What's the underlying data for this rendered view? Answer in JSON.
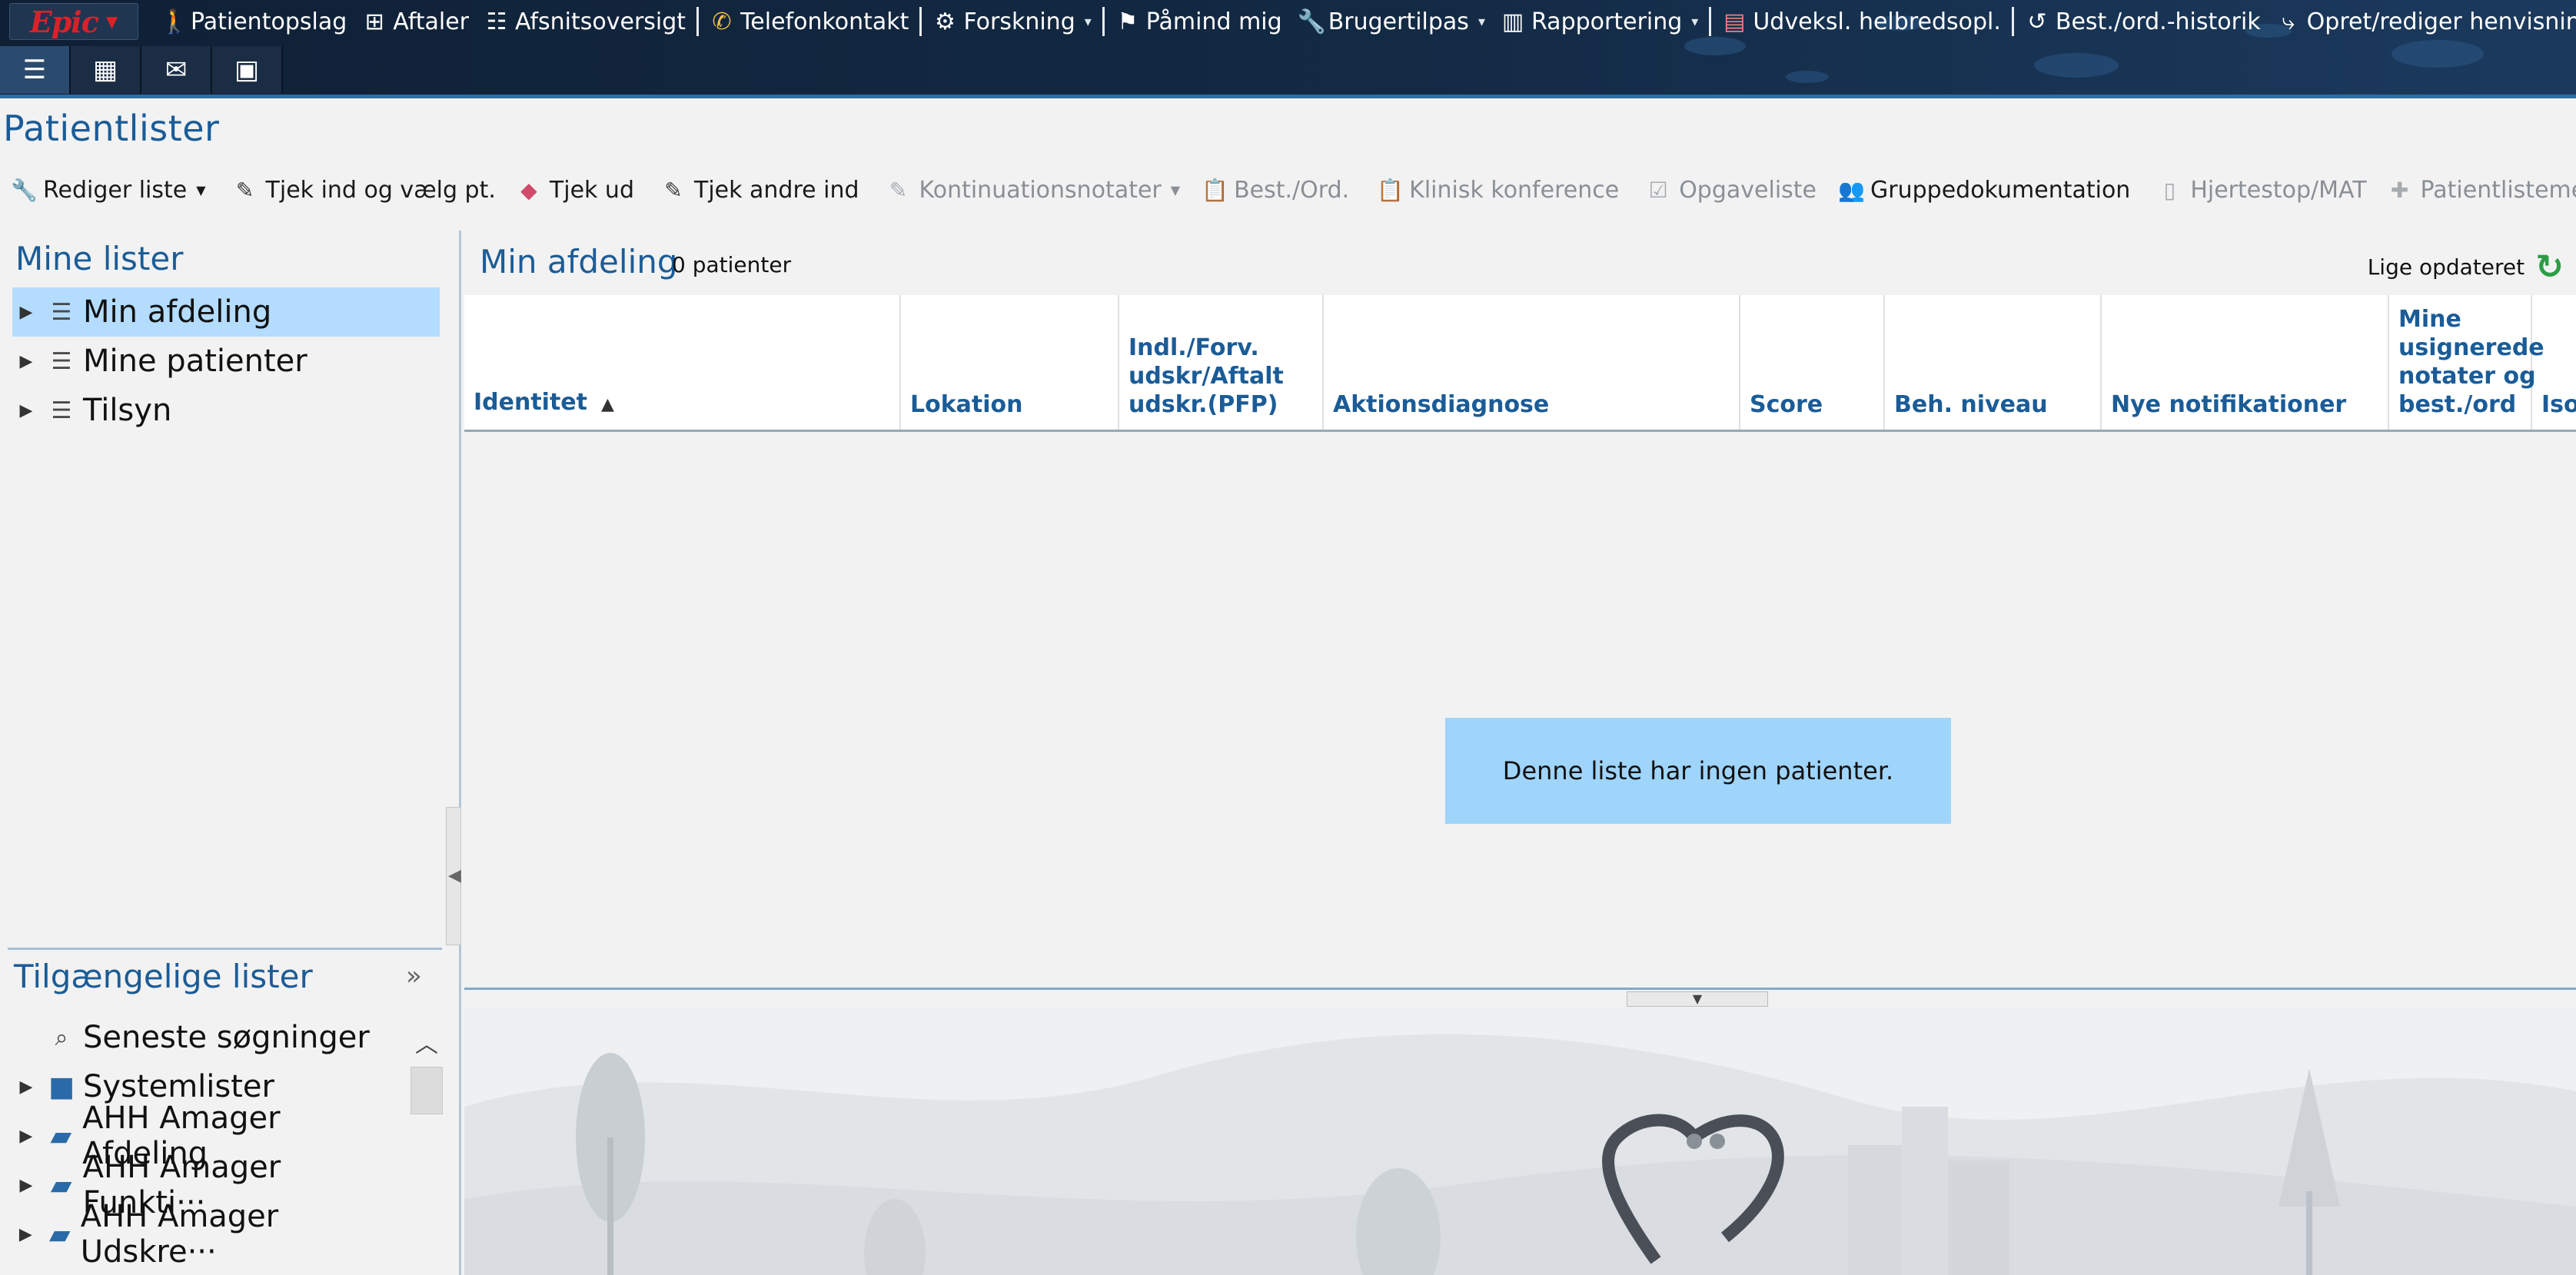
{
  "app": {
    "logo": "Epic"
  },
  "menu": [
    {
      "key": "patientopslag",
      "label": "Patientopslag",
      "icon": "person-icon"
    },
    {
      "key": "aftaler",
      "label": "Aftaler",
      "icon": "org-chart-icon"
    },
    {
      "key": "afsnitsoversigt",
      "label": "Afsnitsoversigt",
      "icon": "unit-overview-icon"
    },
    {
      "key": "telefonkontakt",
      "label": "Telefonkontakt",
      "icon": "phone-icon"
    },
    {
      "key": "forskning",
      "label": "Forskning",
      "icon": "research-icon",
      "dropdown": true
    },
    {
      "key": "paamind",
      "label": "Påmind mig",
      "icon": "reminder-flag-icon"
    },
    {
      "key": "brugertilpas",
      "label": "Brugertilpas",
      "icon": "wrench-icon",
      "dropdown": true
    },
    {
      "key": "rapportering",
      "label": "Rapportering",
      "icon": "bar-chart-icon",
      "dropdown": true
    },
    {
      "key": "udveksl",
      "label": "Udveksl. helbredsopl.",
      "icon": "document-exchange-icon"
    },
    {
      "key": "bestord",
      "label": "Best./ord.-historik",
      "icon": "history-icon"
    },
    {
      "key": "henvisning",
      "label": "Opret/rediger henvisning",
      "icon": "referral-icon"
    }
  ],
  "page_title": "Patientlister",
  "toolbar": [
    {
      "key": "rediger",
      "label": "Rediger liste",
      "icon": "wrench-icon",
      "dropdown": true,
      "disabled": false
    },
    {
      "key": "tjekind",
      "label": "Tjek ind og vælg pt.",
      "icon": "pencil-icon",
      "disabled": false
    },
    {
      "key": "tjekud",
      "label": "Tjek ud",
      "icon": "eraser-icon",
      "disabled": false
    },
    {
      "key": "tjekandre",
      "label": "Tjek andre ind",
      "icon": "pencil-icon",
      "disabled": false
    },
    {
      "key": "kontinuation",
      "label": "Kontinuationsnotater",
      "icon": "pencil-icon",
      "dropdown": true,
      "disabled": true
    },
    {
      "key": "bestord",
      "label": "Best./Ord.",
      "icon": "clipboard-icon",
      "disabled": true
    },
    {
      "key": "klinisk",
      "label": "Klinisk konference",
      "icon": "clipboard-icon",
      "disabled": true
    },
    {
      "key": "opgaveliste",
      "label": "Opgaveliste",
      "icon": "checklist-icon",
      "disabled": true
    },
    {
      "key": "gruppedok",
      "label": "Gruppedokumentation",
      "icon": "group-icon",
      "disabled": false
    },
    {
      "key": "hjertestop",
      "label": "Hjertestop/MAT",
      "icon": "monitor-icon",
      "disabled": true
    },
    {
      "key": "medlem",
      "label": "Patientlistemedlemsk",
      "icon": "plus-icon",
      "disabled": true
    }
  ],
  "my_lists": {
    "title": "Mine lister",
    "items": [
      {
        "label": "Min afdeling",
        "selected": true
      },
      {
        "label": "Mine patienter",
        "selected": false
      },
      {
        "label": "Tilsyn",
        "selected": false
      }
    ]
  },
  "available_lists": {
    "title": "Tilgængelige lister",
    "items": [
      {
        "label": "Seneste søgninger",
        "type": "search",
        "expandable": false
      },
      {
        "label": "Systemlister",
        "type": "folder",
        "expandable": true
      },
      {
        "label": "AHH Amager Afdeling",
        "type": "folder-open",
        "expandable": true
      },
      {
        "label": "AHH Amager Funkti···",
        "type": "folder-open",
        "expandable": true
      },
      {
        "label": "AHH Amager Udskre···",
        "type": "folder-open",
        "expandable": true
      }
    ]
  },
  "list_view": {
    "name": "Min afdeling",
    "count_label": "0 patienter",
    "updated_label": "Lige opdateret",
    "columns": [
      {
        "label": "Identitet",
        "sorted": "asc"
      },
      {
        "label": "Lokation"
      },
      {
        "label": "Indl./Forv.\nudskr/Aftalt\nudskr.(PFP)"
      },
      {
        "label": "Aktionsdiagnose"
      },
      {
        "label": "Score"
      },
      {
        "label": "Beh. niveau"
      },
      {
        "label": "Nye notifikationer"
      },
      {
        "label": "Mine\nusignerede\nnotater og\nbest./ord"
      },
      {
        "label": "Iso"
      }
    ],
    "empty_message": "Denne liste har ingen patienter."
  },
  "colors": {
    "accent": "#1b5c97",
    "selected_row": "#b3dcff",
    "empty_box": "#9fd4fb",
    "logo_red": "#d8222a"
  }
}
